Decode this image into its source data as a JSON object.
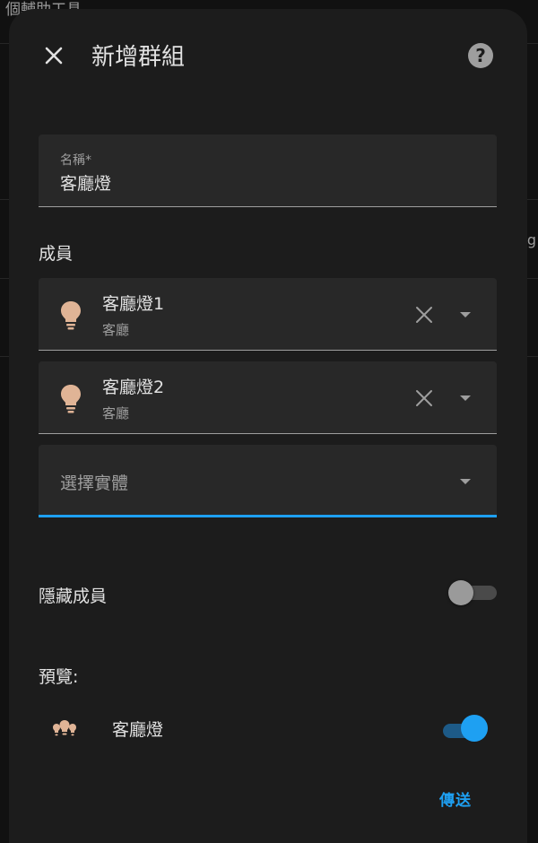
{
  "background": {
    "title": "個輔助工具",
    "edge_text": "g"
  },
  "dialog": {
    "title": "新增群組",
    "close_icon": "close-icon",
    "help_icon": "help-icon"
  },
  "name_field": {
    "label": "名稱*",
    "value": "客廳燈"
  },
  "members": {
    "label": "成員",
    "items": [
      {
        "name": "客廳燈1",
        "area": "客廳",
        "icon": "lightbulb-icon"
      },
      {
        "name": "客廳燈2",
        "area": "客廳",
        "icon": "lightbulb-icon"
      }
    ],
    "picker_placeholder": "選擇實體"
  },
  "hide_members": {
    "label": "隱藏成員",
    "on": false
  },
  "preview": {
    "label": "預覽:",
    "entity_name": "客廳燈",
    "icon": "lightbulb-group-icon",
    "on": true
  },
  "actions": {
    "submit_label": "傳送"
  },
  "colors": {
    "accent": "#1ea0f2",
    "dialog_bg": "#1c1c1c",
    "field_bg": "#282828",
    "bulb": "#e0b496"
  }
}
